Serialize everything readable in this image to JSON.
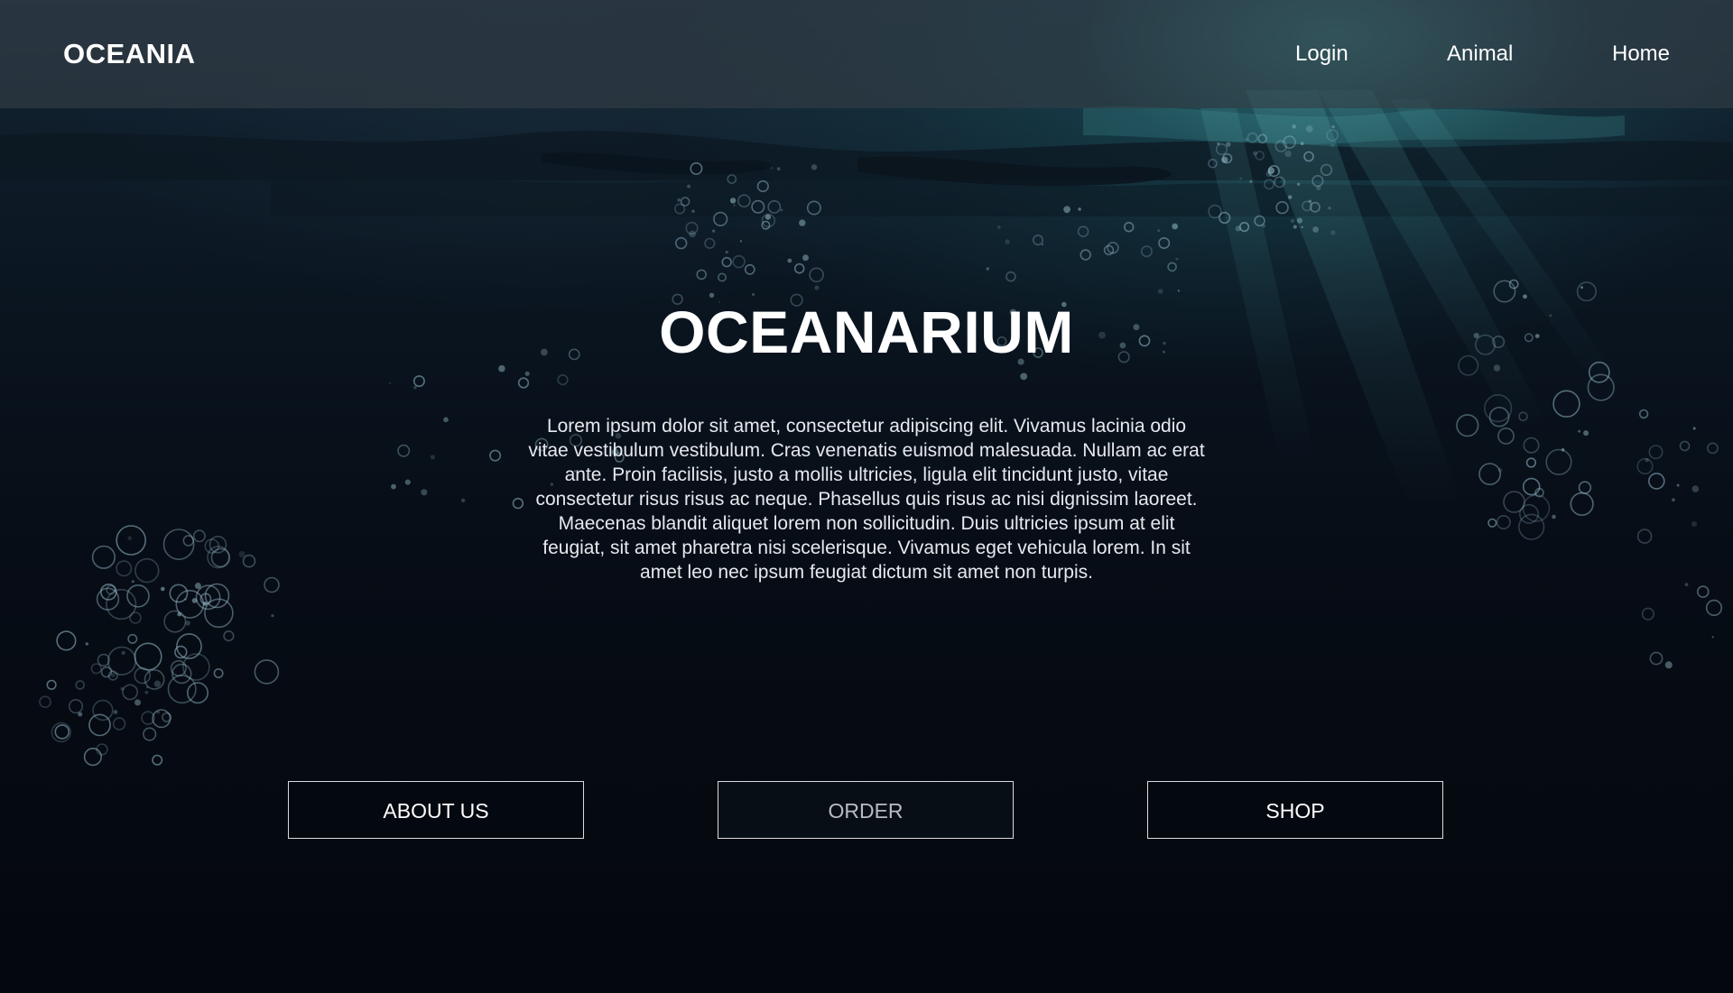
{
  "nav": {
    "brand": "OCEANIA",
    "links": [
      {
        "label": "Login"
      },
      {
        "label": "Animal"
      },
      {
        "label": "Home"
      }
    ]
  },
  "hero": {
    "title": "OCEANARIUM",
    "body": "Lorem ipsum dolor sit amet, consectetur adipiscing elit. Vivamus lacinia odio vitae vestibulum vestibulum. Cras venenatis euismod malesuada. Nullam ac erat ante. Proin facilisis, justo a mollis ultricies, ligula elit tincidunt justo, vitae consectetur risus risus ac neque. Phasellus quis risus ac nisi dignissim laoreet. Maecenas blandit aliquet lorem non sollicitudin. Duis ultricies ipsum at elit feugiat, sit amet pharetra nisi scelerisque. Vivamus eget vehicula lorem. In sit amet leo nec ipsum feugiat dictum sit amet non turpis."
  },
  "buttons": [
    {
      "label": "ABOUT US"
    },
    {
      "label": "ORDER"
    },
    {
      "label": "SHOP"
    }
  ],
  "colors": {
    "navbar_bg": "#343e46",
    "page_bg": "#05080e",
    "text": "#ffffff",
    "order_text": "#b7bcc3",
    "button_border": "#d8dde2"
  }
}
